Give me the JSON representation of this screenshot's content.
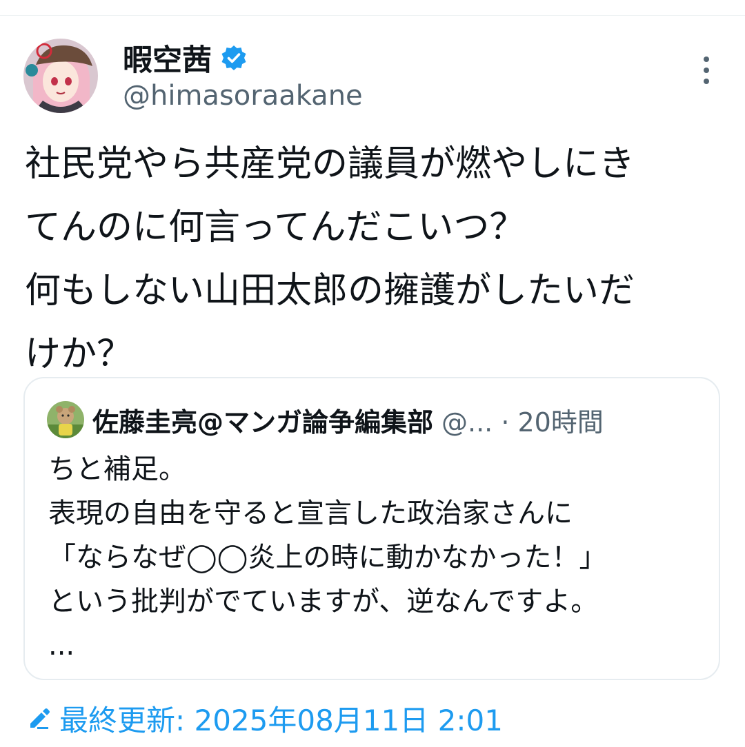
{
  "tweet": {
    "author": {
      "name": "暇空茜",
      "handle": "@himasoraakane"
    },
    "text": "社民党やら共産党の議員が燃やしにき\nてんのに何言ってんだこいつ？\n何もしない山田太郎の擁護がしたいだ\nけか？"
  },
  "quoted": {
    "name": "佐藤圭亮@マンガ論争編集部",
    "meta": "@... · 20時間",
    "text": "ちと補足。\n表現の自由を守ると宣言した政治家さんに\n「ならなぜ◯◯炎上の時に動かなかった！」\nという批判がでていますが、逆なんですよ。\n..."
  },
  "footer": {
    "label": "最終更新: 2025年08月11日 2:01"
  },
  "colors": {
    "accent": "#1d9bf0",
    "secondary_text": "#536471",
    "border": "#e6ecf0"
  },
  "icons": [
    "verified-badge-icon",
    "more-options-icon",
    "edit-pencil-icon"
  ]
}
